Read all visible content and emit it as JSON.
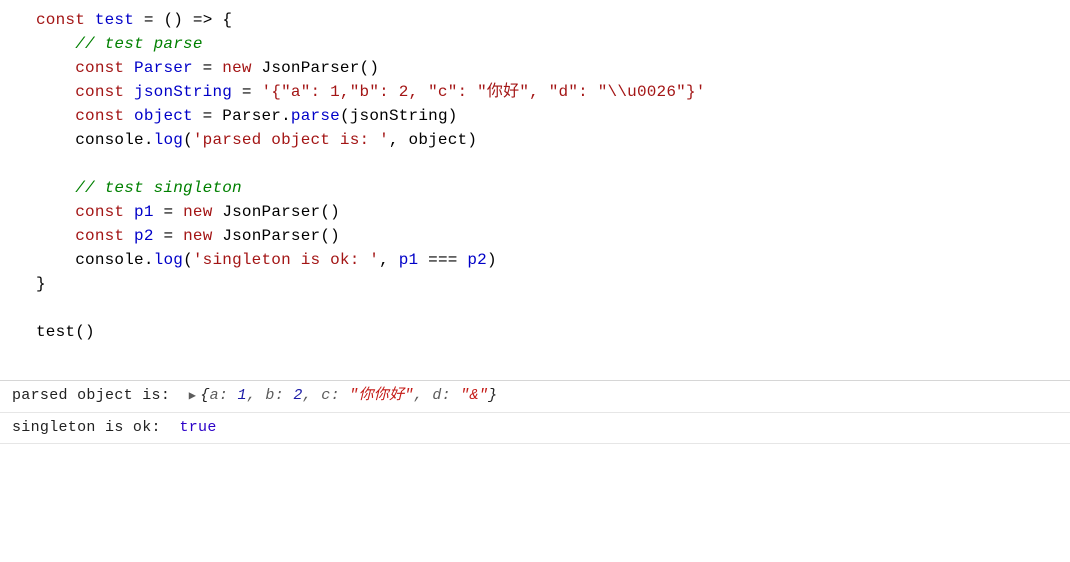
{
  "code": {
    "l1": {
      "const": "const",
      "name": "test",
      "eq": "=",
      "paren": "()",
      "arrow": "=>",
      "brace": "{"
    },
    "l2_comment": "// test parse",
    "l3": {
      "const": "const",
      "name": "Parser",
      "eq": "=",
      "newkw": "new",
      "cls": "JsonParser",
      "paren": "()"
    },
    "l4": {
      "const": "const",
      "name": "jsonString",
      "eq": "=",
      "str": "'{\"a\": 1,\"b\": 2, \"c\": \"你好\", \"d\": \"\\\\u0026\"}'"
    },
    "l5": {
      "const": "const",
      "name": "object",
      "eq": "=",
      "call_obj": "Parser",
      "call_fn": "parse",
      "arg": "jsonString"
    },
    "l6": {
      "obj": "console",
      "fn": "log",
      "str": "'parsed object is: '",
      "arg": "object"
    },
    "l7_comment": "// test singleton",
    "l8": {
      "const": "const",
      "name": "p1",
      "eq": "=",
      "newkw": "new",
      "cls": "JsonParser",
      "paren": "()"
    },
    "l9": {
      "const": "const",
      "name": "p2",
      "eq": "=",
      "newkw": "new",
      "cls": "JsonParser",
      "paren": "()"
    },
    "l10": {
      "obj": "console",
      "fn": "log",
      "str": "'singleton is ok: '",
      "a": "p1",
      "op": "===",
      "b": "p2"
    },
    "l11_brace": "}",
    "l12": {
      "name": "test",
      "paren": "()"
    }
  },
  "console": {
    "row1": {
      "label": "parsed object is:  ",
      "open": "{",
      "pairs": [
        {
          "k": "a",
          "v": "1",
          "t": "num"
        },
        {
          "k": "b",
          "v": "2",
          "t": "num"
        },
        {
          "k": "c",
          "v": "\"你你好\"",
          "t": "str"
        },
        {
          "k": "d",
          "v": "\"&\"",
          "t": "str"
        }
      ],
      "close": "}"
    },
    "row2": {
      "label": "singleton is ok:  ",
      "value": "true"
    }
  }
}
